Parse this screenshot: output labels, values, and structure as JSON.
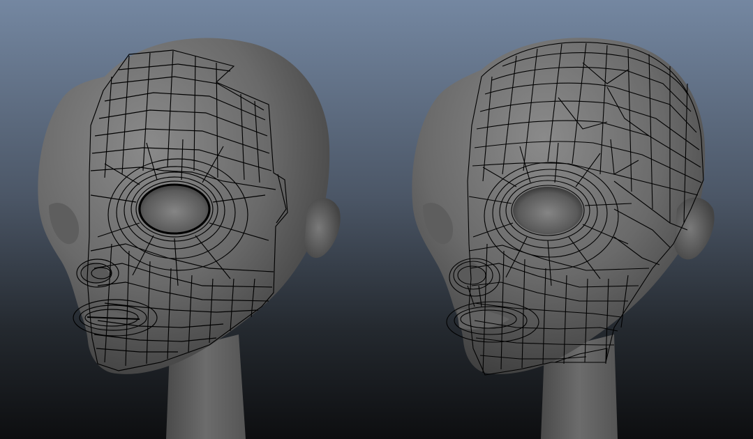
{
  "viewport": {
    "background_top": "#7487a1",
    "background_bottom": "#0d0e10",
    "mesh_shading": "#666666",
    "wireframe_color": "#000000"
  },
  "models": [
    {
      "name": "head-left",
      "wireframe": "partial"
    },
    {
      "name": "head-right",
      "wireframe": "full"
    }
  ]
}
